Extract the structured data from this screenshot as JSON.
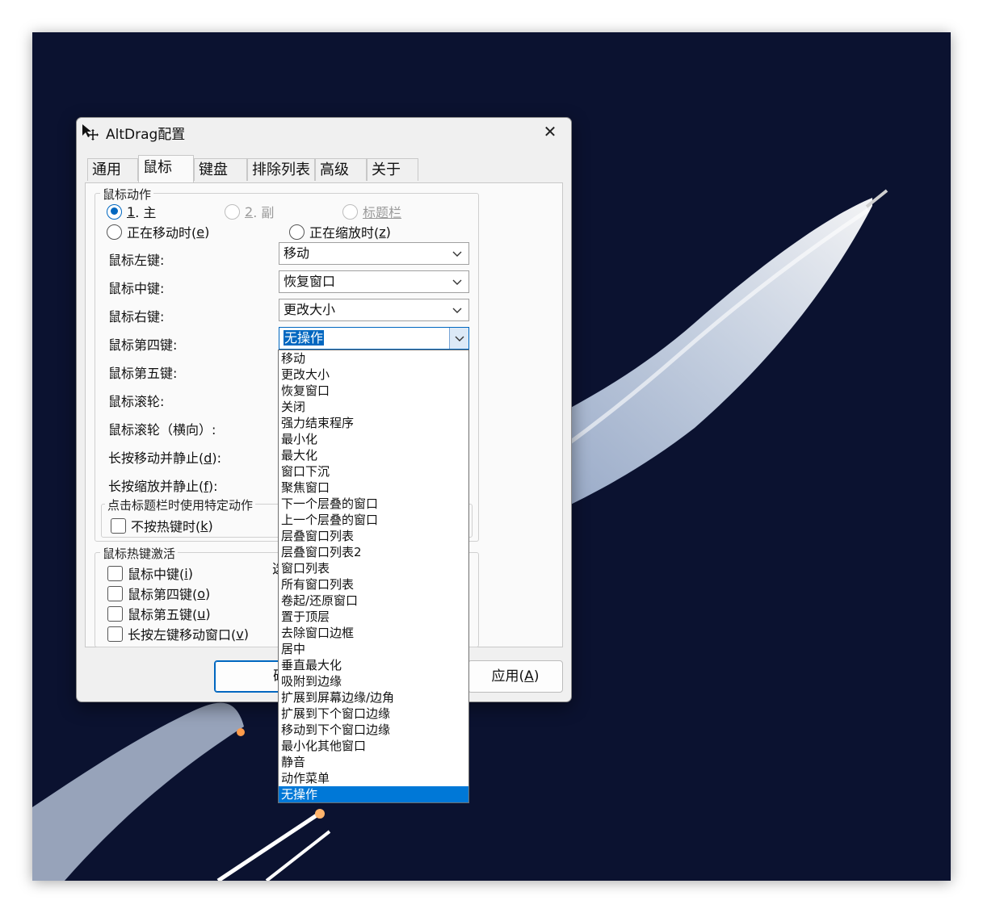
{
  "window": {
    "title": "AltDrag配置",
    "close_glyph": "✕"
  },
  "tabs": [
    {
      "label": "通用"
    },
    {
      "label": "鼠标"
    },
    {
      "label": "键盘"
    },
    {
      "label": "排除列表"
    },
    {
      "label": "高级"
    },
    {
      "label": "关于"
    }
  ],
  "active_tab": "鼠标",
  "mouse_actions": {
    "legend": "鼠标动作",
    "radios": {
      "primary": {
        "num": "1",
        "text": ". 主"
      },
      "secondary": {
        "num": "2",
        "text": ". 副"
      },
      "titlebar": {
        "text": "标题栏"
      },
      "while_moving": {
        "text": "正在移动时(",
        "key": "e",
        "end": ")"
      },
      "while_resizing": {
        "text": "正在缩放时(",
        "key": "z",
        "end": ")"
      }
    },
    "rows": [
      {
        "label": "鼠标左键:",
        "value": "移动"
      },
      {
        "label": "鼠标中键:",
        "value": "恢复窗口"
      },
      {
        "label": "鼠标右键:",
        "value": "更改大小"
      },
      {
        "label": "鼠标第四键:",
        "value": "无操作"
      },
      {
        "label": "鼠标第五键:"
      },
      {
        "label": "鼠标滚轮:"
      },
      {
        "label": "鼠标滚轮（横向）:"
      },
      {
        "label": "长按移动并静止(",
        "key": "d",
        "end": "):"
      },
      {
        "label": "长按缩放并静止(",
        "key": "f",
        "end": "):"
      }
    ],
    "titlebar_group": {
      "legend": "点击标题栏时使用特定动作",
      "checkbox": {
        "text": "不按热键时(",
        "key": "k",
        "end": ")"
      }
    }
  },
  "hotkeys": {
    "legend": "鼠标热键激活",
    "partial_label": "选",
    "items": [
      {
        "text": "鼠标中键(",
        "key": "i",
        "end": ")"
      },
      {
        "text": "鼠标第四键(",
        "key": "o",
        "end": ")"
      },
      {
        "text": "鼠标第五键(",
        "key": "u",
        "end": ")"
      },
      {
        "text": "长按左键移动窗口(",
        "key": "v",
        "end": ")"
      }
    ]
  },
  "buttons": {
    "ok_partial": "确定",
    "apply": "应用(",
    "apply_key": "A",
    "apply_end": ")"
  },
  "dropdown": {
    "options": [
      "移动",
      "更改大小",
      "恢复窗口",
      "关闭",
      "强力结束程序",
      "最小化",
      "最大化",
      "窗口下沉",
      "聚焦窗口",
      "下一个层叠的窗口",
      "上一个层叠的窗口",
      "层叠窗口列表",
      "层叠窗口列表2",
      "窗口列表",
      "所有窗口列表",
      "卷起/还原窗口",
      "置于顶层",
      "去除窗口边框",
      "居中",
      "垂直最大化",
      "吸附到边缘",
      "扩展到屏幕边缘/边角",
      "扩展到下个窗口边缘",
      "移动到下个窗口边缘",
      "最小化其他窗口",
      "静音",
      "动作菜单",
      "无操作"
    ],
    "selected": "无操作"
  },
  "colors": {
    "accent": "#0067c0",
    "selection": "#0078d7",
    "wallpaper": "#0b1230"
  }
}
